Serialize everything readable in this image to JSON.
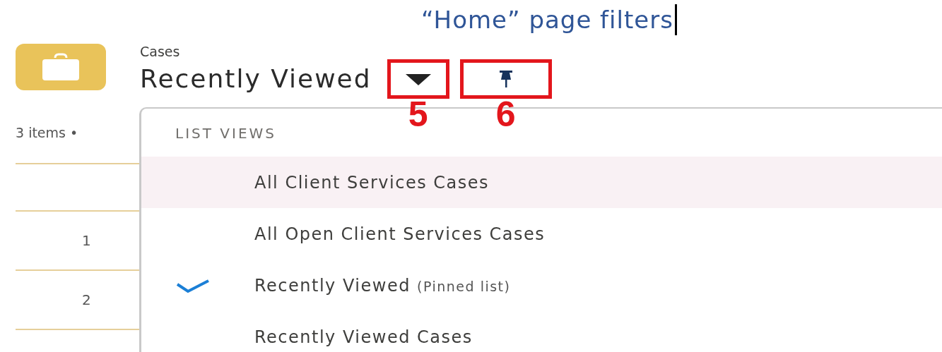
{
  "annotation": {
    "caption": "“Home” page filters",
    "markers": [
      {
        "label": "5"
      },
      {
        "label": "6"
      }
    ]
  },
  "header": {
    "object": "Cases",
    "title": "Recently Viewed"
  },
  "list": {
    "count": "3 items •",
    "rows": [
      {
        "number": "1"
      },
      {
        "number": "2"
      }
    ]
  },
  "menu": {
    "heading": "LIST VIEWS",
    "items": [
      {
        "label": "All Client Services Cases",
        "highlighted": true,
        "selected": false
      },
      {
        "label": "All Open Client Services Cases",
        "highlighted": false,
        "selected": false
      },
      {
        "label": "Recently Viewed",
        "suffix": "(Pinned list)",
        "highlighted": false,
        "selected": true
      },
      {
        "label": "Recently Viewed Cases",
        "highlighted": false,
        "selected": false
      }
    ]
  }
}
